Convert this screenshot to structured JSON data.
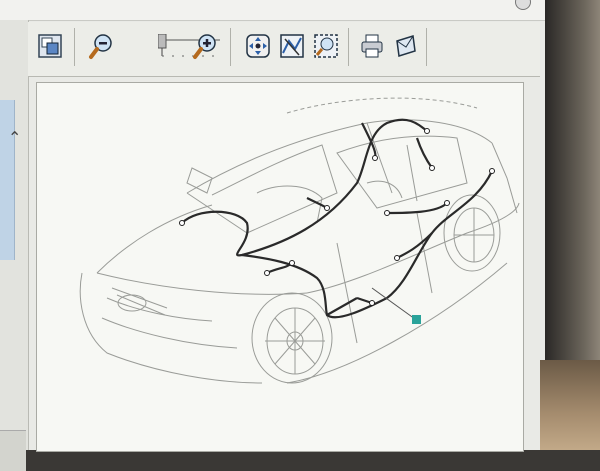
{
  "toolbar": {
    "icons": [
      {
        "name": "fit-window-icon"
      },
      {
        "name": "zoom-out-icon"
      },
      {
        "name": "zoom-slider"
      },
      {
        "name": "zoom-in-icon"
      },
      {
        "name": "pan-icon"
      },
      {
        "name": "highlight-harness-icon"
      },
      {
        "name": "zoom-area-icon"
      },
      {
        "name": "print-icon"
      },
      {
        "name": "export-icon"
      }
    ]
  },
  "sidebar": {
    "expand_icon": "chevron-up-icon"
  },
  "diagram": {
    "harness_color": "#2a2a2a",
    "marker_color": "#2aa39a",
    "outline_color": "#9a9c98"
  }
}
